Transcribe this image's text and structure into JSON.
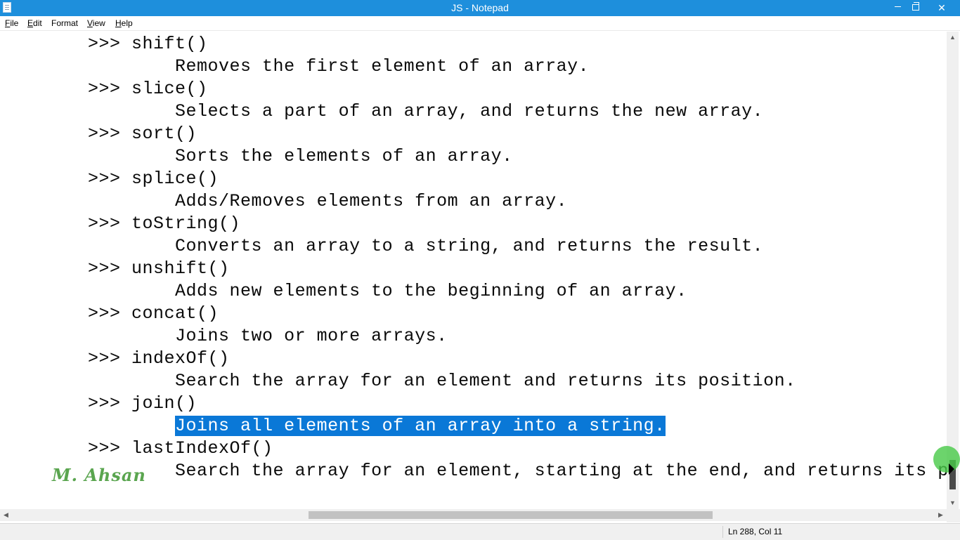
{
  "window": {
    "title": "JS - Notepad"
  },
  "menu": [
    {
      "accel": "F",
      "rest": "ile"
    },
    {
      "accel": "E",
      "rest": "dit"
    },
    {
      "accel": "F",
      "rest": "ormat",
      "prefix": ""
    },
    {
      "accel": "V",
      "rest": "iew"
    },
    {
      "accel": "H",
      "rest": "elp"
    }
  ],
  "menu_labels": {
    "file_a": "F",
    "file_b": "ile",
    "edit_a": "E",
    "edit_b": "dit",
    "format_a": "",
    "format_b": "Format",
    "view_a": "V",
    "view_b": "iew",
    "help_a": "H",
    "help_b": "elp"
  },
  "editor": {
    "lines": [
      "        >>> shift()",
      "                Removes the first element of an array.",
      "        >>> slice()",
      "                Selects a part of an array, and returns the new array.",
      "        >>> sort()",
      "                Sorts the elements of an array.",
      "        >>> splice()",
      "                Adds/Removes elements from an array.",
      "        >>> toString()",
      "                Converts an array to a string, and returns the result.",
      "        >>> unshift()",
      "                Adds new elements to the beginning of an array.",
      "        >>> concat()",
      "                Joins two or more arrays.",
      "        >>> indexOf()",
      "                Search the array for an element and returns its position.",
      "        >>> join()",
      "                ",
      "        >>> lastIndexOf()",
      "                Search the array for an element, starting at the end, and returns its posi"
    ],
    "selected_text": "Joins all elements of an array into a string."
  },
  "status": {
    "position": "Ln 288, Col 11"
  },
  "watermark": "M. Ahsan",
  "colors": {
    "titlebar": "#1e8fdc",
    "selection": "#0a78d7"
  }
}
